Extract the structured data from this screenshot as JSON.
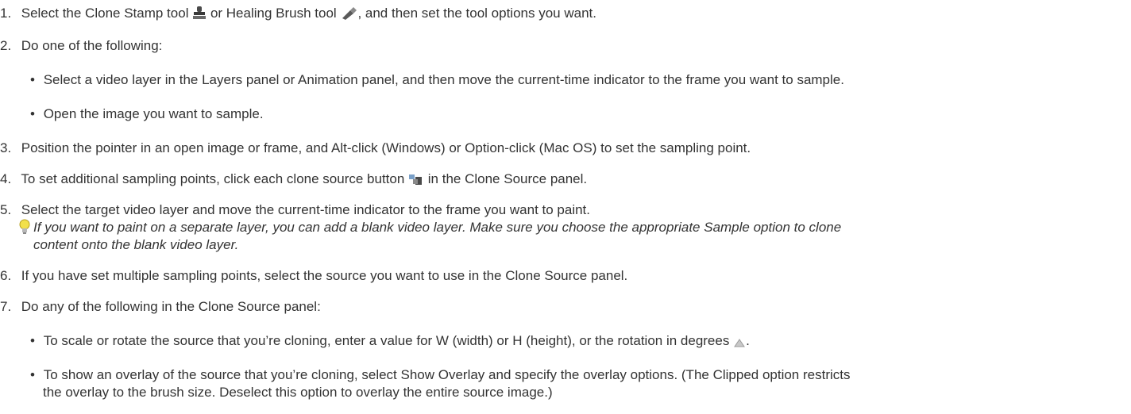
{
  "steps": [
    {
      "number": "1.",
      "text_before": "Select the Clone Stamp tool",
      "text_mid": "or Healing Brush tool",
      "text_after": ", and then set the tool options you want."
    },
    {
      "number": "2.",
      "text": "Do one of the following:",
      "bullets": [
        "Select a video layer in the Layers panel or Animation panel, and then move the current-time indicator to the frame you want to sample.",
        "Open the image you want to sample."
      ]
    },
    {
      "number": "3.",
      "text": "Position the pointer in an open image or frame, and Alt-click (Windows) or Option-click (Mac OS) to set the sampling point."
    },
    {
      "number": "4.",
      "text_before": "To set additional sampling points, click each clone source button",
      "text_after": "in the Clone Source panel."
    },
    {
      "number": "5.",
      "text": "Select the target video layer and move the current-time indicator to the frame you want to paint.",
      "tip_line1": "If you want to paint on a separate layer, you can add a blank video layer. Make sure you choose the appropriate Sample option to clone",
      "tip_line2": "content onto the blank video layer."
    },
    {
      "number": "6.",
      "text": "If you have set multiple sampling points, select the source you want to use in the Clone Source panel."
    },
    {
      "number": "7.",
      "text": "Do any of the following in the Clone Source panel:",
      "bullets": [
        "To scale or rotate the source that you’re cloning, enter a value for W (width) or H (height), or the rotation in degrees",
        "To show an overlay of the source that you’re cloning, select Show Overlay and specify the overlay options. (The Clipped option restricts",
        "the overlay to the brush size. Deselect this option to overlay the entire source image.)"
      ],
      "bullet1_suffix": "."
    }
  ],
  "bullet_glyph": "•",
  "icons": [
    "clone-stamp-icon",
    "healing-brush-icon",
    "clone-source-button-icon",
    "tip-lightbulb-icon",
    "rotation-icon"
  ]
}
